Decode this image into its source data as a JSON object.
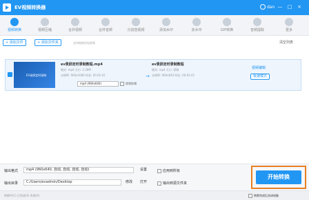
{
  "titlebar": {
    "title": "EV视频转换器",
    "user": "dan",
    "minimize_label": "—",
    "maximize_label": "□",
    "close_label": "×"
  },
  "toolbar": {
    "tools": [
      {
        "label": "视频转换"
      },
      {
        "label": "视频压缩"
      },
      {
        "label": "合并视频"
      },
      {
        "label": "合并音频"
      },
      {
        "label": "分割音视频"
      },
      {
        "label": "添加水印"
      },
      {
        "label": "去水印"
      },
      {
        "label": "GIF转换"
      },
      {
        "label": "音频提取"
      },
      {
        "label": "更多"
      }
    ]
  },
  "actions": {
    "add_file": "+ 添加文件",
    "add_folder": "+ 添加文件夹",
    "hint": "支持拖拽添加视频",
    "clear": "清空列表"
  },
  "file": {
    "thumb_text": "EV录屏定时录制",
    "src_name": "ev录屏定时录制教程.mp4",
    "src_meta_row1": "格式:    mp4    大小:    2.38M",
    "src_meta_row2": "分辨率:  960x1080   时长:    00:01:41",
    "format_select": "mp4 (960x640)",
    "source_check": "视频剪辑",
    "out_name": "ev录屏定时录制教程",
    "out_meta_row1": "格式:    mp4    大小:    获取",
    "out_meta_row2": "分辨率:  960x640   时长:    00:01:41",
    "edit_link": "视频编辑",
    "fast_mode": "极速模式",
    "arrow_icon": "→"
  },
  "bottom": {
    "format_label": "输出格式",
    "format_value": "mp4 (960x640, 自动, 自动, 自动, 自动)",
    "settings": "设置",
    "apply_all": "应用到所有",
    "dir_label": "输出目录",
    "dir_value": "C:/Users/evadmin/Desktop",
    "modify": "修改",
    "open": "打开",
    "open_after": "输出到源文件夹",
    "start": "开始转换",
    "shutdown": "转换完成后关闭电脑"
  },
  "status": {
    "text": "转换中(1)    已完成(0)    失败(0)"
  },
  "colors": {
    "accent": "#2196F3",
    "highlight": "#e67e22"
  }
}
